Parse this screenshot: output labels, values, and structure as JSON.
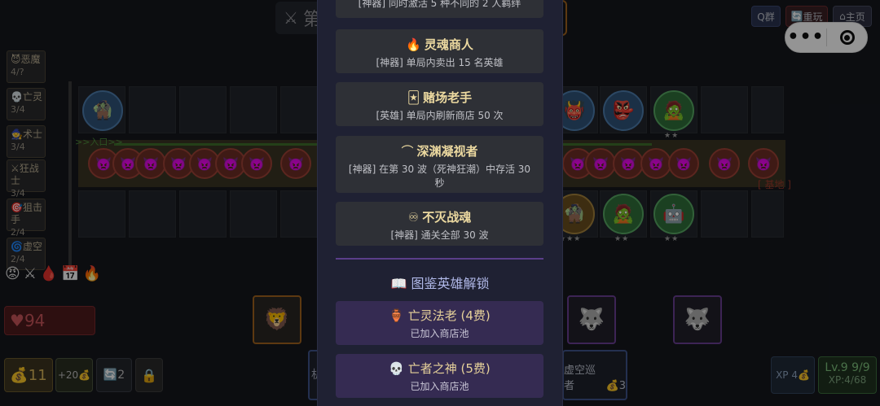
{
  "topbar": {
    "title_partial": "第",
    "q_group": "Q群",
    "replay": "重玩",
    "home": "主页"
  },
  "synergies": [
    {
      "name": "恶魔",
      "count": "4/?",
      "icon": "demon-icon"
    },
    {
      "name": "亡灵",
      "count": "3/4",
      "icon": "skull-icon"
    },
    {
      "name": "术士",
      "count": "3/4",
      "icon": "warlock-icon"
    },
    {
      "name": "狂战士",
      "count": "3/4",
      "icon": "crossed-swords-icon"
    },
    {
      "name": "狙击手",
      "count": "2/4",
      "icon": "target-icon"
    },
    {
      "name": "虚空",
      "count": "2/4",
      "icon": "void-icon"
    }
  ],
  "board": {
    "entry_label": ">>入口>>",
    "base_label": "[ 基地 ]",
    "stars_2": "★★",
    "stars_3": "★★★"
  },
  "player": {
    "hp": "94",
    "gold": "11",
    "income": "+20",
    "refresh_count": "2",
    "level": "Lv.9 9/9",
    "xp": "XP:4/68",
    "xp_button": "XP 4",
    "card_left_partial": "机",
    "card_right": "虚空巡者",
    "card_right_cost": "3"
  },
  "achievements": [
    {
      "title": "",
      "desc": "[神器] 同时激活 5 种不同的 2 人羁绊",
      "icon": ""
    },
    {
      "title": "灵魂商人",
      "desc": "[神器] 单局内卖出 15 名英雄",
      "icon": "🔥"
    },
    {
      "title": "赌场老手",
      "desc": "[英雄] 单局内刷新商店 50 次",
      "icon": "🃏"
    },
    {
      "title": "深渊凝视者",
      "desc": "[神器] 在第 30 波（死神狂潮）中存活 30 秒",
      "icon": "⌒"
    },
    {
      "title": "不灭战魂",
      "desc": "[神器] 通关全部 30 波",
      "icon": "♾"
    }
  ],
  "unlock_section": {
    "title": "图鉴英雄解锁",
    "icon": "📖",
    "items": [
      {
        "title": "亡灵法老 (4费)",
        "status": "已加入商店池",
        "icon": "🏺"
      },
      {
        "title": "亡者之神 (5费)",
        "status": "已加入商店池",
        "icon": "💀"
      }
    ]
  },
  "colors": {
    "panel_bg": "#1f2133",
    "card_bg": "#2e3036",
    "unlock_bg": "#352b52",
    "title_gold": "#ecd9a0",
    "divider_purple": "#5a3e8a"
  }
}
